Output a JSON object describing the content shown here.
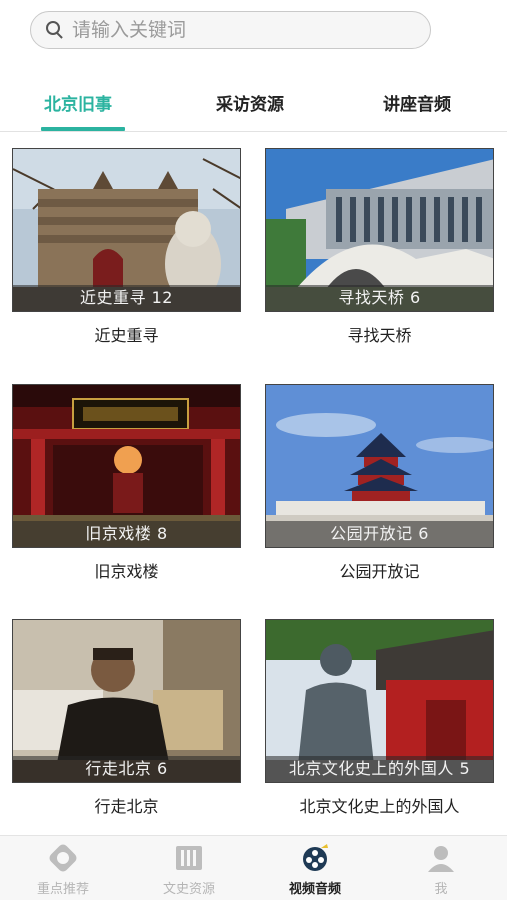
{
  "search": {
    "placeholder": "请输入关键词"
  },
  "tabs": [
    {
      "label": "北京旧事"
    },
    {
      "label": "采访资源"
    },
    {
      "label": "讲座音频"
    }
  ],
  "cards": [
    {
      "overlay": "近史重寻 12",
      "title": "近史重寻"
    },
    {
      "overlay": "寻找天桥 6",
      "title": "寻找天桥"
    },
    {
      "overlay": "旧京戏楼 8",
      "title": "旧京戏楼"
    },
    {
      "overlay": "公园开放记 6",
      "title": "公园开放记"
    },
    {
      "overlay": "行走北京 6",
      "title": "行走北京"
    },
    {
      "overlay": "北京文化史上的外国人 5",
      "title": "北京文化史上的外国人"
    }
  ],
  "bottom_nav": [
    {
      "label": "重点推荐",
      "icon": "recommend-icon"
    },
    {
      "label": "文史资源",
      "icon": "resources-icon"
    },
    {
      "label": "视频音频",
      "icon": "video-audio-icon"
    },
    {
      "label": "我",
      "icon": "profile-icon"
    }
  ],
  "colors": {
    "accent": "#2bb3a0",
    "inactive_nav": "#b5b5b5"
  }
}
